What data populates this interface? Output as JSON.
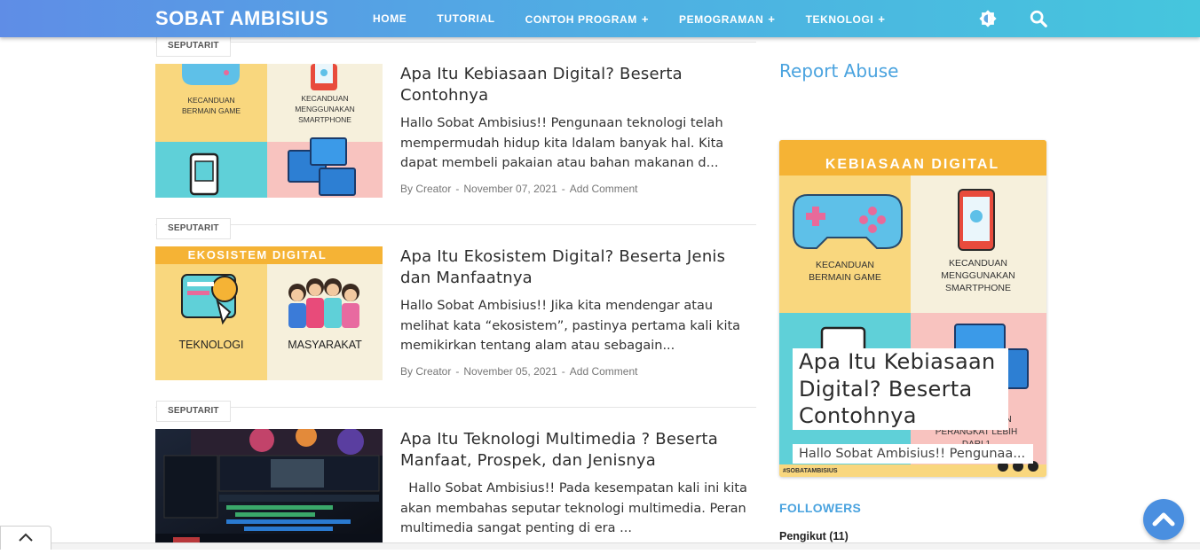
{
  "header": {
    "brand": "SOBAT AMBISIUS",
    "nav": [
      {
        "label": "HOME",
        "has_submenu": false
      },
      {
        "label": "TUTORIAL",
        "has_submenu": false
      },
      {
        "label": "CONTOH PROGRAM",
        "has_submenu": true
      },
      {
        "label": "PEMOGRAMAN",
        "has_submenu": true
      },
      {
        "label": "TEKNOLOGI",
        "has_submenu": true
      }
    ],
    "submenu_symbol": "+",
    "theme_icon": "theme-toggle-icon",
    "search_icon": "search-icon"
  },
  "posts": [
    {
      "tag": "SEPUTARIT",
      "title": "Apa Itu Kebiasaan Digital? Beserta Contohnya",
      "excerpt": "Hallo Sobat Ambisius!! Pengunaan teknologi telah mempermudah hidup kita ldalam banyak hal. Kita dapat membeli pakaian atau bahan makanan d...",
      "author": "By Creator",
      "date": "November 07, 2021",
      "comment_link": "Add Comment",
      "thumb": {
        "label_left": "KECANDUAN BERMAIN GAME",
        "label_right": "KECANDUAN MENGGUNAKAN SMARTPHONE"
      }
    },
    {
      "tag": "SEPUTARIT",
      "title": "Apa Itu Ekosistem Digital? Beserta Jenis dan Manfaatnya",
      "excerpt": "Hallo Sobat Ambisius!! Jika kita mendengar atau melihat kata “ekosistem”, pastinya pertama kali kita memikirkan tentang alam atau sebagain...",
      "author": "By Creator",
      "date": "November 05, 2021",
      "comment_link": "Add Comment",
      "thumb": {
        "banner": "EKOSISTEM DIGITAL",
        "label_left": "TEKNOLOGI",
        "label_right": "MASYARAKAT"
      }
    },
    {
      "tag": "SEPUTARIT",
      "title": "Apa Itu Teknologi Multimedia ? Beserta Manfaat, Prospek, dan Jenisnya",
      "excerpt": "  Hallo Sobat Ambisius!! Pada kesempatan kali ini kita akan membahas seputar teknologi multimedia. Peran multimedia sangat penting di era ..."
    }
  ],
  "sidebar": {
    "report_abuse": "Report Abuse",
    "featured": {
      "banner": "KEBIASAAN DIGITAL",
      "label_game": "KECANDUAN BERMAIN GAME",
      "label_phone": "KECANDUAN MENGGUNAKAN SMARTPHONE",
      "label_device": "MENGGUNAKAN PERANGKAT LEBIH DARI 1",
      "hashtag": "#SOBATAMBISIUS",
      "title": "Apa Itu Kebiasaan Digital? Beserta Contohnya",
      "excerpt": "Hallo Sobat Ambisius!! Pengunaa..."
    },
    "followers_heading": "FOLLOWERS",
    "followers_count": "Pengikut (11)"
  },
  "colors": {
    "accent": "#4aa3df",
    "header_start": "#5f8de6",
    "header_end": "#45c6dd",
    "scroll_button": "#4a8fe0",
    "thumb_yellow": "#f9d77e",
    "thumb_cream": "#f6f0dc",
    "thumb_teal": "#5fd0d8",
    "thumb_pink": "#f8c3bf",
    "banner_orange": "#f5b335"
  },
  "icons": {
    "scroll_top": "chevron-up-icon",
    "collapse": "chevron-up-icon"
  }
}
